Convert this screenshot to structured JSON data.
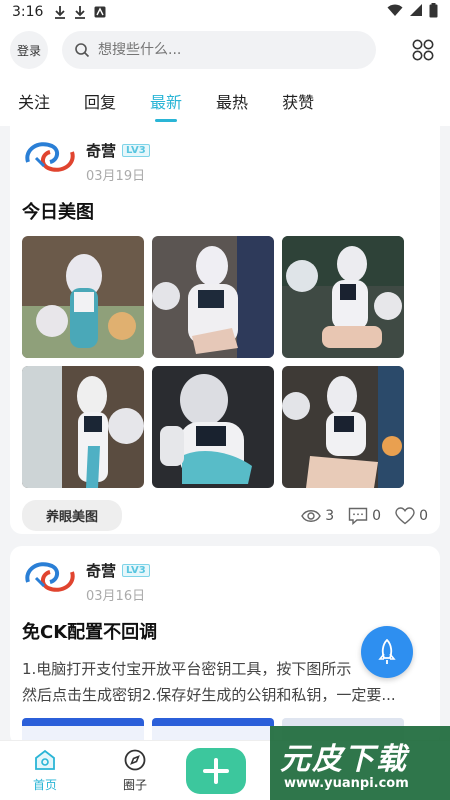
{
  "statusbar": {
    "time": "3:16"
  },
  "topbar": {
    "login_label": "登录",
    "search_placeholder": "想搜些什么..."
  },
  "tabs": [
    {
      "label": "关注"
    },
    {
      "label": "回复"
    },
    {
      "label": "最新",
      "active": true
    },
    {
      "label": "最热"
    },
    {
      "label": "获赞"
    }
  ],
  "posts": [
    {
      "author": "奇营",
      "level": "LV3",
      "date": "03月19日",
      "title": "今日美图",
      "tag": "养眼美图",
      "views": "3",
      "comments": "0",
      "likes": "0",
      "photo_count": 6
    },
    {
      "author": "奇营",
      "level": "LV3",
      "date": "03月16日",
      "title": "免CK配置不回调",
      "excerpt_line1": "1.电脑打开支付宝开放平台密钥工具，按下图所示",
      "excerpt_line2": "然后点击生成密钥2.保存好生成的公钥和私钥，一定要..."
    }
  ],
  "bottomnav": {
    "home_label": "首页",
    "circle_label": "圈子"
  },
  "watermark": {
    "title": "元皮下载",
    "url": "www.yuanpi.com"
  },
  "colors": {
    "accent": "#2ab5d6",
    "add_button": "#3cc79d",
    "rocket": "#2e8ff0"
  }
}
